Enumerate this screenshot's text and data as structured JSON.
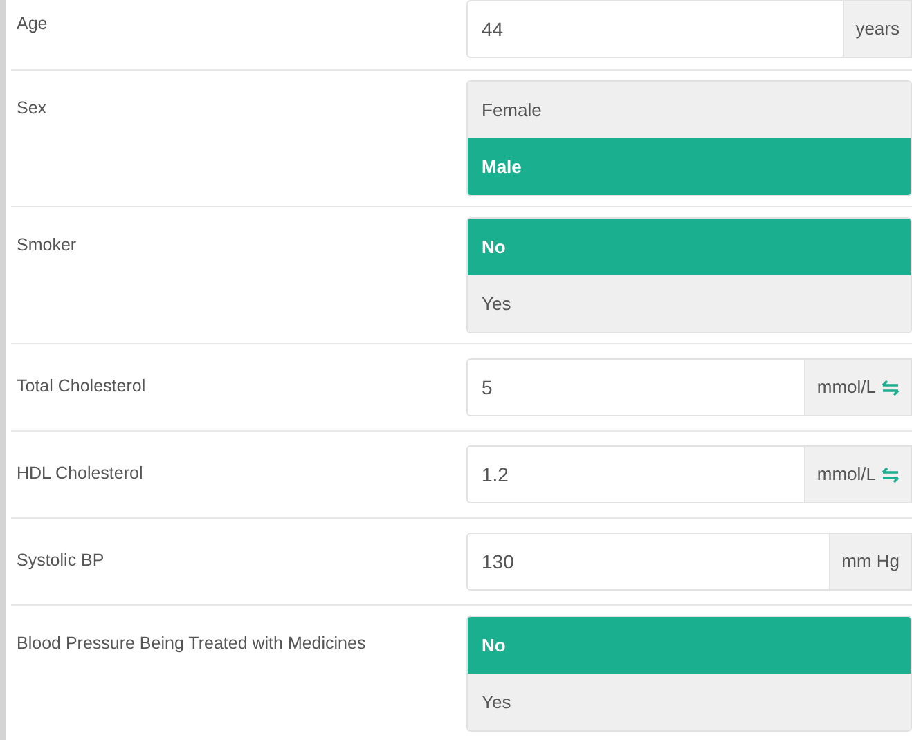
{
  "fields": [
    {
      "kind": "number",
      "label": "Age",
      "value": "44",
      "unit": "years",
      "convertible": false
    },
    {
      "kind": "choice",
      "label": "Sex",
      "options": [
        {
          "label": "Female",
          "selected": false
        },
        {
          "label": "Male",
          "selected": true
        }
      ]
    },
    {
      "kind": "choice",
      "label": "Smoker",
      "options": [
        {
          "label": "No",
          "selected": true
        },
        {
          "label": "Yes",
          "selected": false
        }
      ]
    },
    {
      "kind": "number",
      "label": "Total Cholesterol",
      "value": "5",
      "unit": "mmol/L",
      "convertible": true
    },
    {
      "kind": "number",
      "label": "HDL Cholesterol",
      "value": "1.2",
      "unit": "mmol/L",
      "convertible": true
    },
    {
      "kind": "number",
      "label": "Systolic BP",
      "value": "130",
      "unit": "mm Hg",
      "convertible": false
    },
    {
      "kind": "choice",
      "label": "Blood Pressure Being Treated with Medicines",
      "options": [
        {
          "label": "No",
          "selected": true
        },
        {
          "label": "Yes",
          "selected": false
        }
      ]
    }
  ]
}
